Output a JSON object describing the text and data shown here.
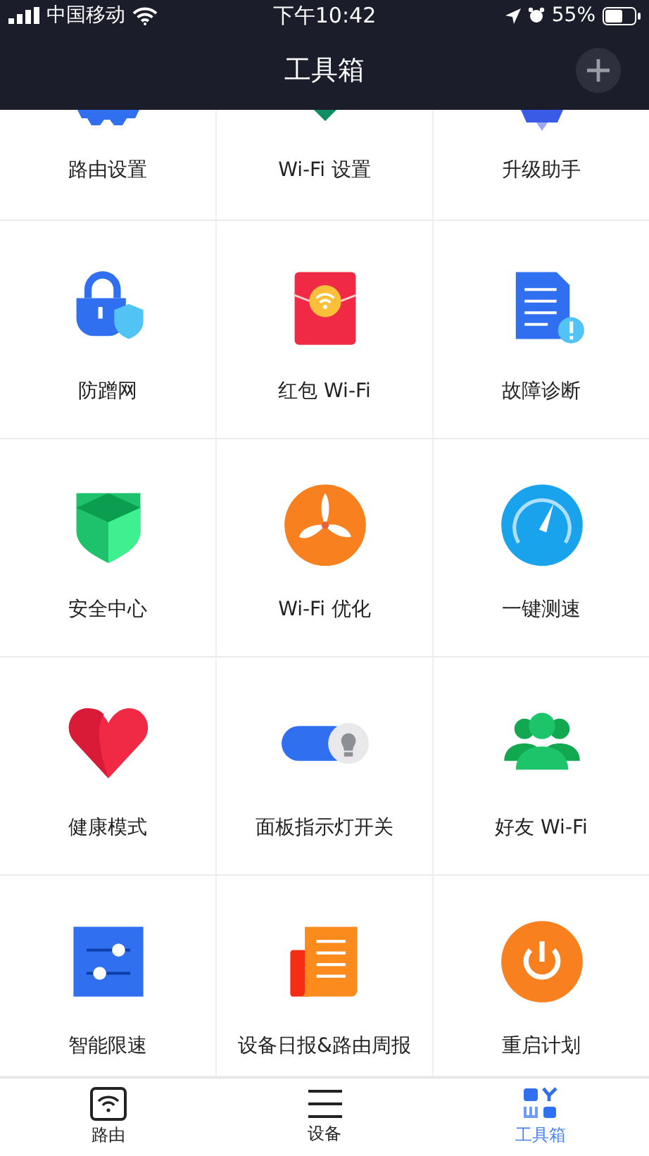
{
  "status_bar": {
    "carrier": "中国移动",
    "time": "下午10:42",
    "battery": "55%"
  },
  "nav": {
    "title": "工具箱"
  },
  "tools": [
    {
      "label": "路由设置",
      "kind": "gear",
      "cut": true
    },
    {
      "label": "Wi-Fi 设置",
      "kind": "diamond",
      "cut": true
    },
    {
      "label": "升级助手",
      "kind": "rocket",
      "cut": true
    },
    {
      "label": "防蹭网",
      "kind": "lock",
      "cut": false
    },
    {
      "label": "红包 Wi-Fi",
      "kind": "envelope",
      "cut": false
    },
    {
      "label": "故障诊断",
      "kind": "document",
      "cut": false
    },
    {
      "label": "安全中心",
      "kind": "shield",
      "cut": false
    },
    {
      "label": "Wi-Fi 优化",
      "kind": "fan",
      "cut": false
    },
    {
      "label": "一键测速",
      "kind": "gauge",
      "cut": false
    },
    {
      "label": "健康模式",
      "kind": "heart",
      "cut": false
    },
    {
      "label": "面板指示灯开关",
      "kind": "toggle",
      "cut": false
    },
    {
      "label": "好友 Wi-Fi",
      "kind": "people",
      "cut": false
    },
    {
      "label": "智能限速",
      "kind": "sliders",
      "cut": false
    },
    {
      "label": "设备日报&路由周报",
      "kind": "report",
      "cut": false
    },
    {
      "label": "重启计划",
      "kind": "power",
      "cut": false
    }
  ],
  "tab_bar": [
    {
      "label": "路由",
      "kind": "router",
      "selected": false
    },
    {
      "label": "设备",
      "kind": "lines",
      "selected": false
    },
    {
      "label": "工具箱",
      "kind": "toolbox",
      "selected": true
    }
  ]
}
